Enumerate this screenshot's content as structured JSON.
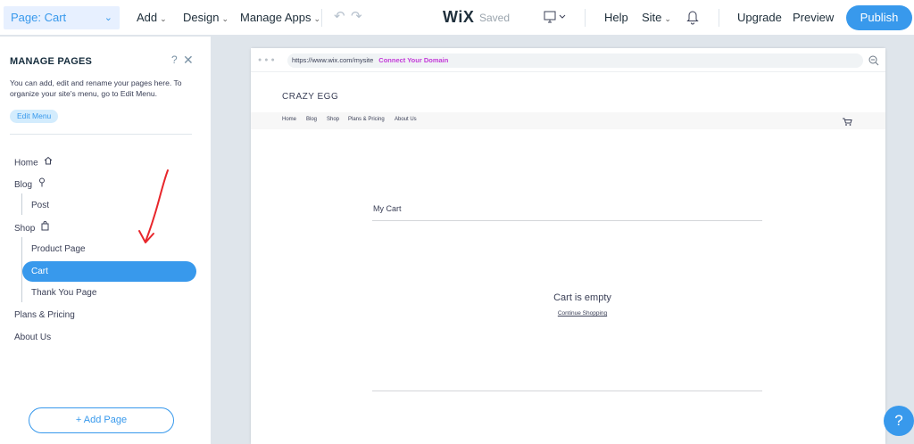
{
  "topbar": {
    "page_select": "Page: Cart",
    "menus": [
      "Add",
      "Design",
      "Manage Apps"
    ],
    "logo": "WiX",
    "saved": "Saved",
    "help": "Help",
    "site": "Site",
    "upgrade": "Upgrade",
    "preview": "Preview",
    "publish": "Publish",
    "accent": "#3899ec"
  },
  "panel": {
    "title": "MANAGE PAGES",
    "help_glyph": "?",
    "close_glyph": "✕",
    "description": "You can add, edit and rename your pages here. To organize your site's menu, go to Edit Menu.",
    "edit_menu": "Edit Menu",
    "pages": [
      {
        "label": "Home",
        "icon": "home-icon"
      },
      {
        "label": "Blog",
        "icon": "blog-pin-icon"
      },
      {
        "label": "Post"
      },
      {
        "label": "Shop",
        "icon": "shop-bag-icon"
      },
      {
        "label": "Product Page"
      },
      {
        "label": "Cart",
        "selected": true
      },
      {
        "label": "Thank You Page"
      },
      {
        "label": "Plans & Pricing"
      },
      {
        "label": "About Us"
      }
    ],
    "add_page": "+ Add Page",
    "annotation_arrow_color": "#e8262b"
  },
  "browser": {
    "url": "https://www.wix.com/mysite",
    "connect_domain": "Connect Your Domain",
    "site_title": "CRAZY EGG",
    "nav": [
      "Home",
      "Blog",
      "Shop",
      "Plans & Pricing",
      "About Us"
    ],
    "cart_heading": "My Cart",
    "cart_empty": "Cart is empty",
    "continue_shopping": "Continue Shopping"
  },
  "help_bubble": "?"
}
